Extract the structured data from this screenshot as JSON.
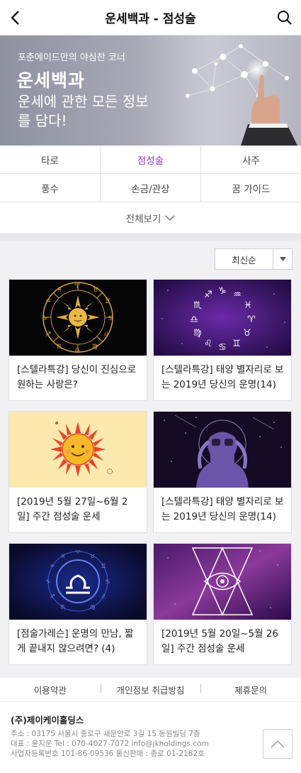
{
  "header": {
    "title": "운세백과 - 점성술",
    "back_icon": "chevron-left-icon",
    "search_icon": "search-icon"
  },
  "banner": {
    "kicker": "포춘에이드만의 야심찬 코너",
    "title": "운세백과",
    "subtitle": "운세에 관한 모든 정보를 담다!"
  },
  "categories": {
    "row1": [
      "타로",
      "점성술",
      "사주"
    ],
    "row2": [
      "풍수",
      "손금/관상",
      "꿈 가이드"
    ],
    "active": "점성술",
    "view_all": "전체보기",
    "accent_color": "#8b3bd1"
  },
  "sort": {
    "selected": "최신순"
  },
  "articles": [
    {
      "title": "[스텔라특강] 당신이 진심으로 원하는 사랑은?",
      "image": "zodiac-sun-wheel"
    },
    {
      "title": "[스텔라특강] 태양 별자리로 보는 2019년 당신의 운명(14)",
      "image": "zodiac-circle-purple"
    },
    {
      "title": "[2019년 5월 27일~6월 2일] 주간 점성술 운세",
      "image": "smiling-sun"
    },
    {
      "title": "[스텔라특강] 태양 별자리로 보는 2019년 당신의 운명(14)",
      "image": "stargazer"
    },
    {
      "title": "[점술가레슨] 운명의 만남, 짧게 끝내지 않으려면? (4)",
      "image": "libra-glow"
    },
    {
      "title": "[2019년 5월 20일~5월 26일] 주간 점성술 운세",
      "image": "mystic-eye-triangle"
    }
  ],
  "footer": {
    "links": [
      "이용약관",
      "개인정보 취급방침",
      "제휴문의"
    ],
    "company": "(주)제이케이홀딩스",
    "address": "주소 : 03175 서울시 종로구 새문안로 3길 15 동원빌딩 7층",
    "contact": "대표 : 윤지운    Tel : 070-4027-7072    info@jkholdings.com",
    "registration": "사업자등록번호 101-86-09536 통신판매 : 종로 01-2182호",
    "top_icon": "chevron-up-icon"
  }
}
